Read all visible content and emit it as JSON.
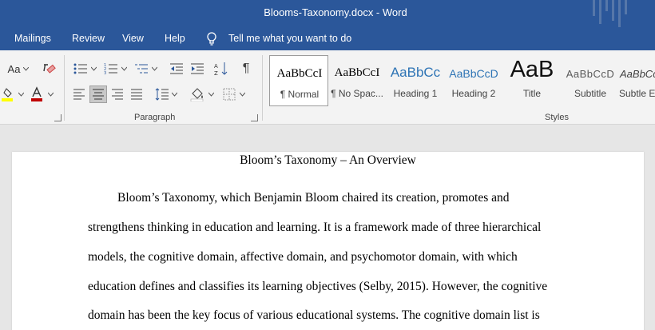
{
  "window": {
    "title": "Blooms-Taxonomy.docx  -  Word"
  },
  "tabs": [
    "Mailings",
    "Review",
    "View",
    "Help"
  ],
  "tell_me": "Tell me what you want to do",
  "ribbon": {
    "font_group": {
      "change_case": "Aa"
    },
    "paragraph_group_label": "Paragraph",
    "styles_group_label": "Styles",
    "styles": [
      {
        "preview": "AaBbCcI",
        "name": "¶ Normal"
      },
      {
        "preview": "AaBbCcI",
        "name": "¶ No Spac..."
      },
      {
        "preview": "AaBbCc",
        "name": "Heading 1"
      },
      {
        "preview": "AaBbCcD",
        "name": "Heading 2"
      },
      {
        "preview": "AaB",
        "name": "Title"
      },
      {
        "preview": "AaBbCcD",
        "name": "Subtitle"
      },
      {
        "preview": "AaBbCcL",
        "name": "Subtle Em"
      }
    ]
  },
  "document": {
    "title": "Bloom’s Taxonomy – An Overview",
    "lines": [
      "Bloom’s Taxonomy, which Benjamin Bloom chaired its creation, promotes and",
      "strengthens thinking in education and learning. It is a framework made of three hierarchical",
      "models, the cognitive domain, affective domain, and psychomotor domain, with which",
      "education defines and classifies its learning objectives (Selby, 2015). However, the cognitive",
      "domain has been the key focus of various educational systems. The cognitive domain list is"
    ]
  },
  "colors": {
    "ribbon_blue": "#2b579a",
    "ribbon_bg": "#f3f3f3",
    "heading_blue": "#2e74b5",
    "highlight_yellow": "#ffff00",
    "font_red": "#c00000"
  }
}
